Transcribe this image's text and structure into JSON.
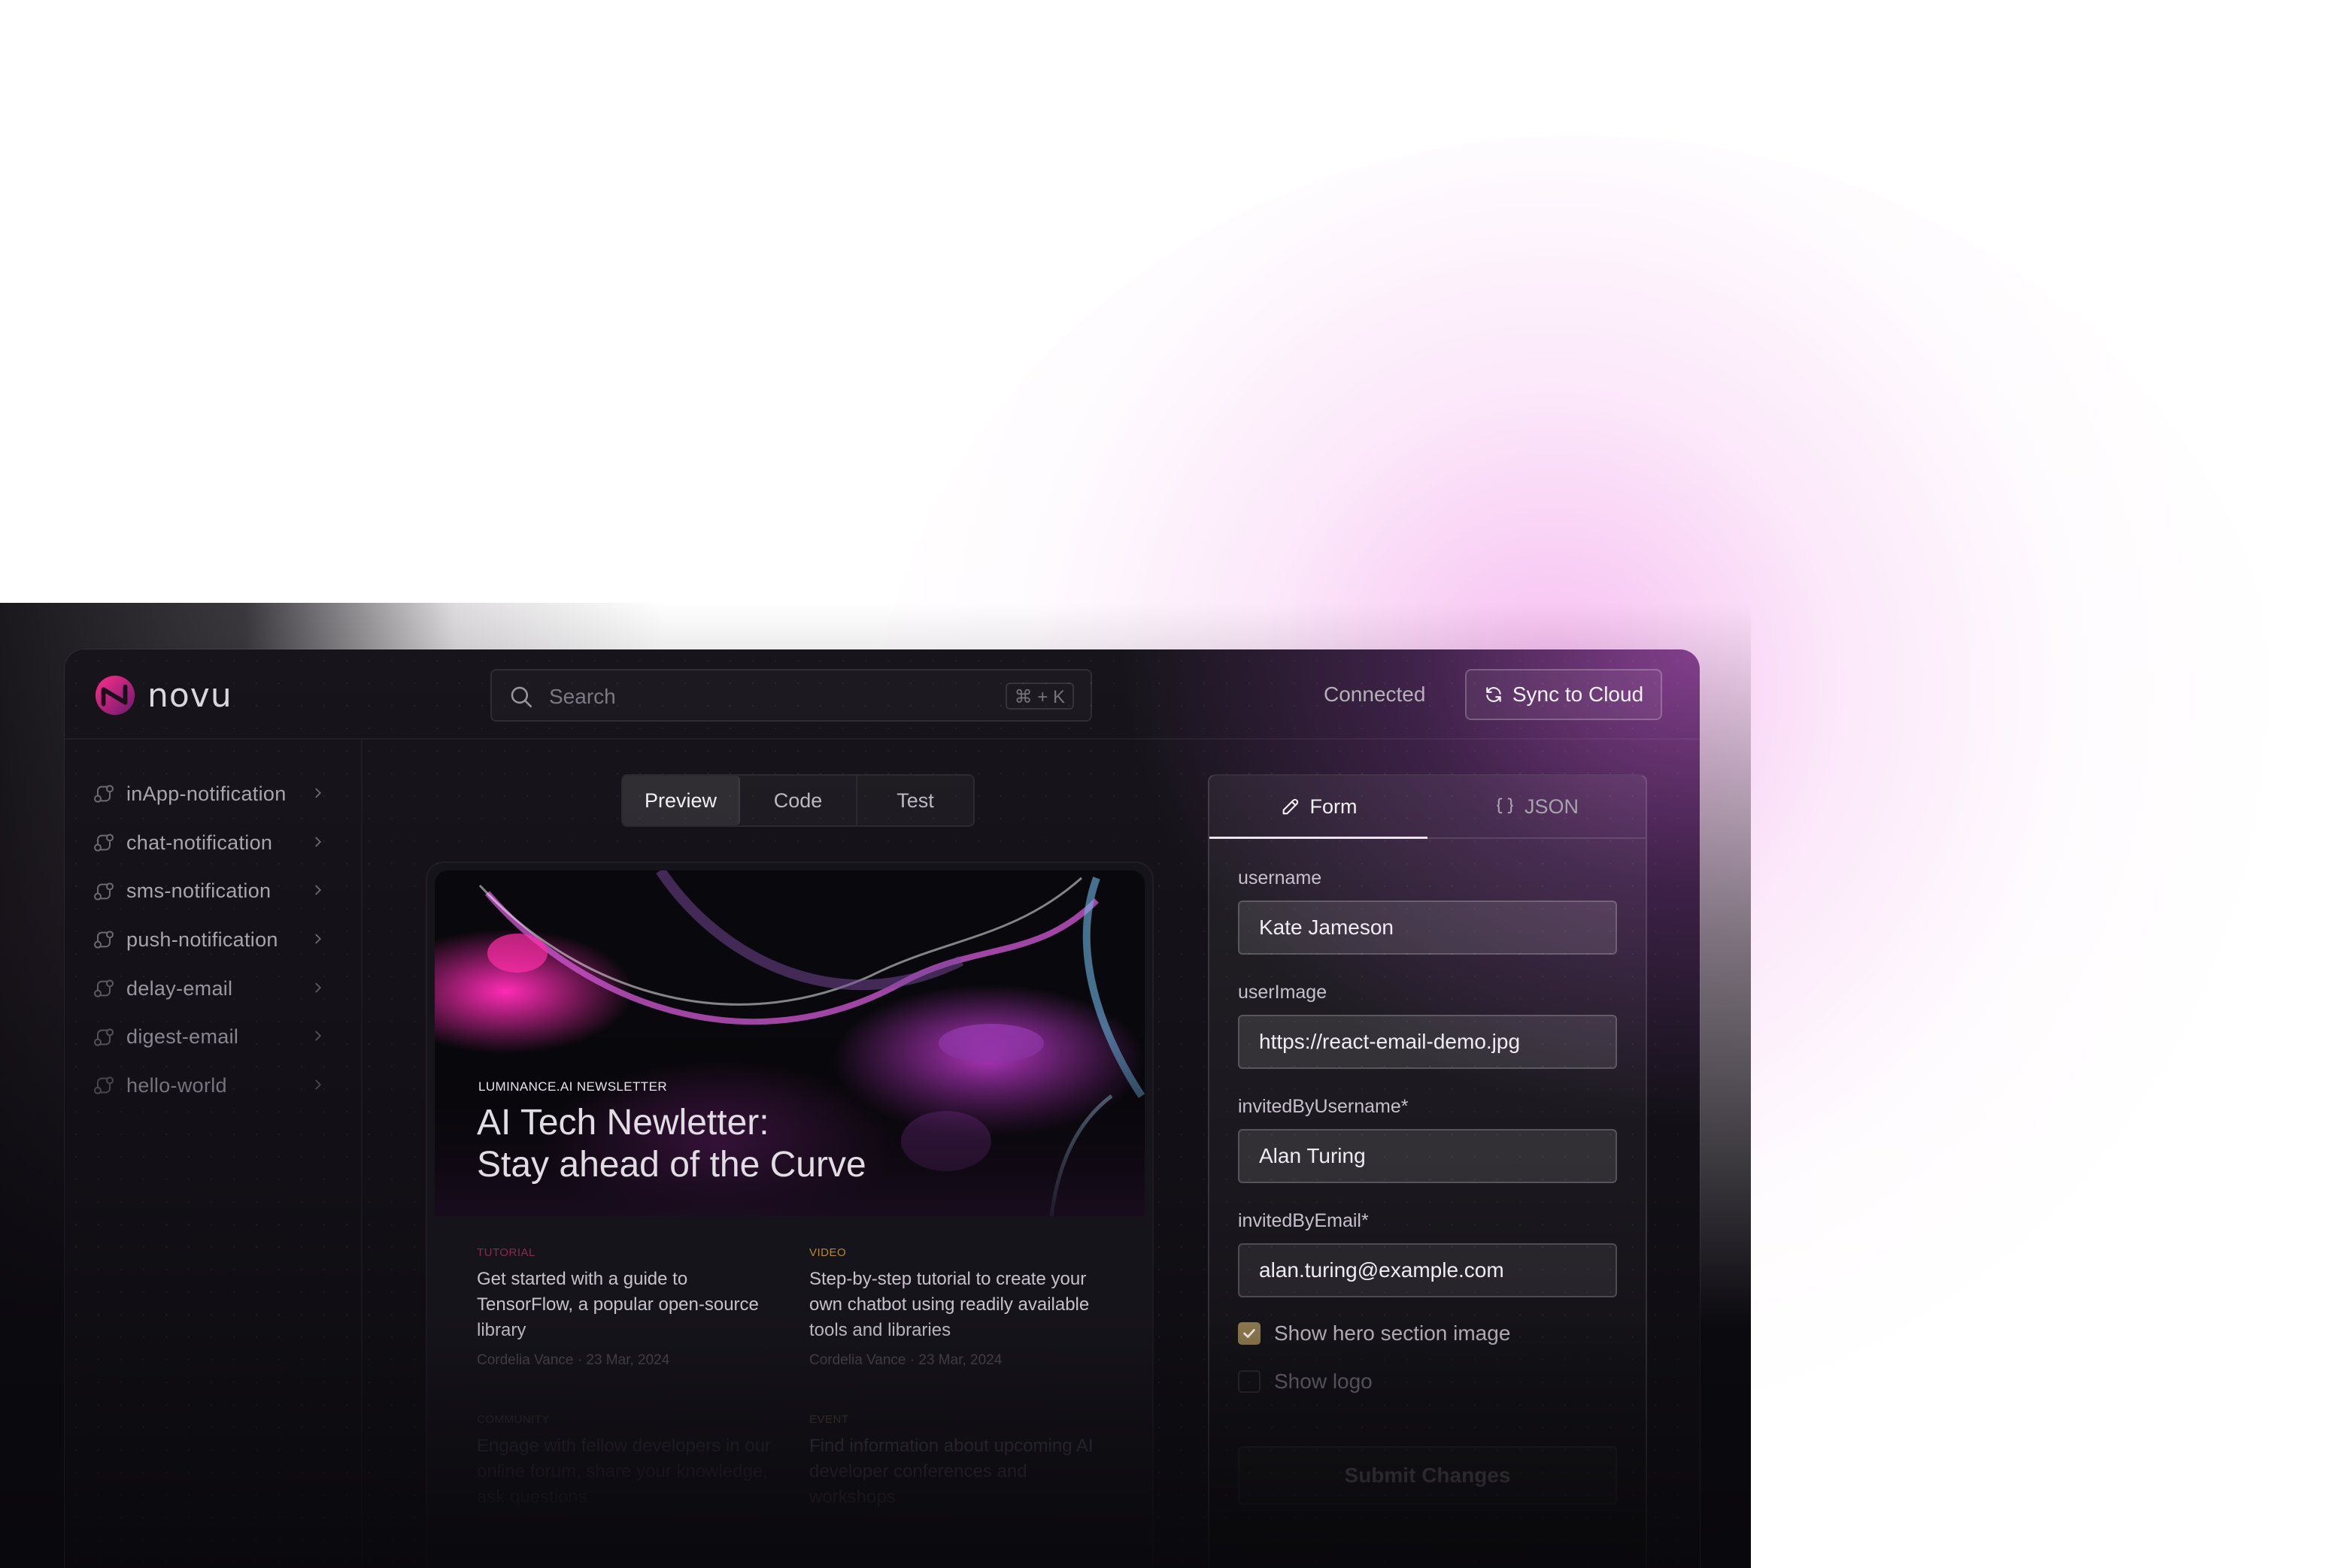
{
  "app": {
    "name": "novu"
  },
  "search": {
    "placeholder": "Search",
    "shortcut": "⌘ + K"
  },
  "header": {
    "status": "Connected",
    "sync_label": "Sync to Cloud"
  },
  "sidebar": {
    "items": [
      {
        "label": "inApp-notification"
      },
      {
        "label": "chat-notification"
      },
      {
        "label": "sms-notification"
      },
      {
        "label": "push-notification"
      },
      {
        "label": "delay-email"
      },
      {
        "label": "digest-email"
      },
      {
        "label": "hello-world"
      }
    ]
  },
  "preview_tabs": [
    {
      "label": "Preview",
      "active": true
    },
    {
      "label": "Code",
      "active": false
    },
    {
      "label": "Test",
      "active": false
    }
  ],
  "email": {
    "eyebrow": "LUMINANCE.AI NEWSLETTER",
    "title_line1": "AI Tech Newletter:",
    "title_line2": "Stay ahead of the Curve",
    "articles": [
      {
        "tag": "TUTORIAL",
        "tag_color": "#8a2a4a",
        "text": "Get started with a guide to TensorFlow, a popular open-source library",
        "meta": "Cordelia Vance · 23 Mar, 2024"
      },
      {
        "tag": "VIDEO",
        "tag_color": "#b8862c",
        "text": "Step-by-step tutorial to create your own chatbot using readily available tools and libraries",
        "meta": "Cordelia Vance · 23 Mar, 2024"
      },
      {
        "tag": "COMMUNITY",
        "tag_color": "#3a3640",
        "text": "Engage with fellow developers in our online forum, share your knowledge, ask questions",
        "meta": ""
      },
      {
        "tag": "EVENT",
        "tag_color": "#5a4a3a",
        "text": "Find information about upcoming AI developer conferences and workshops",
        "meta": ""
      }
    ]
  },
  "panel": {
    "tabs": [
      {
        "label": "Form",
        "icon": "pencil-icon",
        "active": true
      },
      {
        "label": "JSON",
        "icon": "braces-icon",
        "active": false
      }
    ],
    "fields": [
      {
        "label": "username",
        "value": "Kate Jameson"
      },
      {
        "label": "userImage",
        "value": "https://react-email-demo.jpg"
      },
      {
        "label": "invitedByUsername*",
        "value": "Alan Turing"
      },
      {
        "label": "invitedByEmail*",
        "value": "alan.turing@example.com"
      }
    ],
    "checkboxes": [
      {
        "label": "Show hero section image",
        "checked": true
      },
      {
        "label": "Show logo",
        "checked": false
      }
    ],
    "submit_label": "Submit Changes"
  },
  "colors": {
    "accent_pink": "#e0208a",
    "accent_purple": "#9a48a8",
    "checkbox": "#8f7b4f"
  }
}
